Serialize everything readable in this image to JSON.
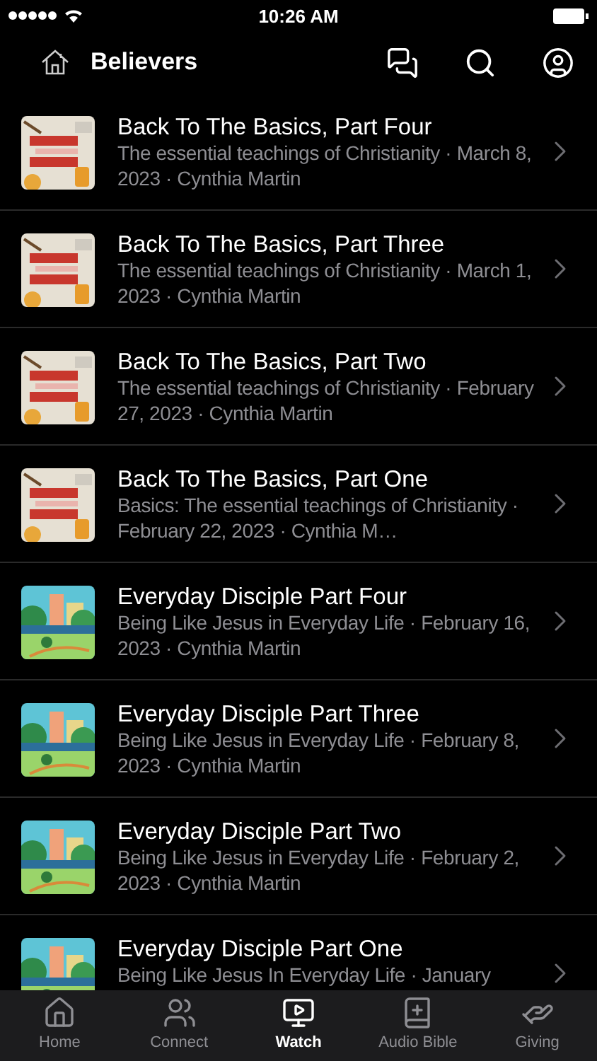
{
  "status_bar": {
    "time": "10:26 AM"
  },
  "header": {
    "title": "Believers"
  },
  "episodes": [
    {
      "kind": "basics",
      "title": "Back To The Basics, Part Four",
      "subtitle": "The essential teachings of Christianity · March 8, 2023 · Cynthia Martin"
    },
    {
      "kind": "basics",
      "title": "Back To The Basics, Part Three",
      "subtitle": "The essential teachings of Christianity · March 1, 2023 · Cynthia Martin"
    },
    {
      "kind": "basics",
      "title": "Back To The Basics, Part Two",
      "subtitle": "The essential teachings of Christianity · February 27, 2023 · Cynthia Martin"
    },
    {
      "kind": "basics",
      "title": "Back To The Basics, Part One",
      "subtitle": "Basics: The essential teachings of Christianity · February 22, 2023 · Cynthia M…"
    },
    {
      "kind": "disciple",
      "title": "Everyday Disciple Part Four",
      "subtitle": "Being Like Jesus in Everyday Life · February 16, 2023 · Cynthia Martin"
    },
    {
      "kind": "disciple",
      "title": "Everyday Disciple Part Three",
      "subtitle": "Being Like Jesus in Everyday Life · February 8, 2023 · Cynthia Martin"
    },
    {
      "kind": "disciple",
      "title": "Everyday Disciple Part Two",
      "subtitle": "Being Like Jesus in Everyday Life · February 2, 2023 · Cynthia Martin"
    },
    {
      "kind": "disciple",
      "title": "Everyday Disciple Part One",
      "subtitle": "Being Like Jesus In Everyday Life · January"
    }
  ],
  "tabs": [
    {
      "kind": "home",
      "label": "Home",
      "selected": false
    },
    {
      "kind": "connect",
      "label": "Connect",
      "selected": false
    },
    {
      "kind": "watch",
      "label": "Watch",
      "selected": true
    },
    {
      "kind": "bible",
      "label": "Audio Bible",
      "selected": false
    },
    {
      "kind": "giving",
      "label": "Giving",
      "selected": false
    }
  ]
}
